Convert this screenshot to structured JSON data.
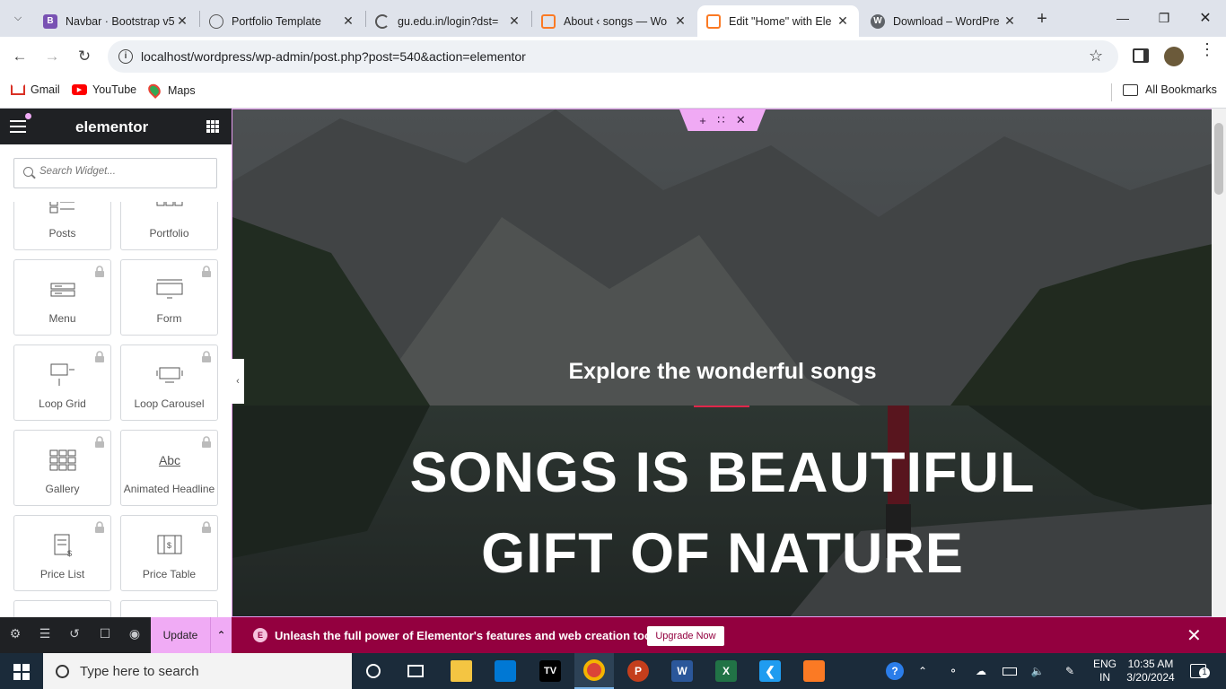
{
  "browser": {
    "tabs": [
      {
        "label": "Navbar · Bootstrap v5",
        "favicon": "bootstrap-icon",
        "color": "#7952b3",
        "glyph": "B"
      },
      {
        "label": "Portfolio Template",
        "favicon": "globe-icon",
        "color": "#5f6368",
        "glyph": ""
      },
      {
        "label": "gu.edu.in/login?dst=",
        "favicon": "loading-icon",
        "color": "#5f6368",
        "glyph": ""
      },
      {
        "label": "About ‹ songs — Wo",
        "favicon": "xampp-icon",
        "color": "#fb7a24",
        "glyph": ""
      },
      {
        "label": "Edit \"Home\" with Ele",
        "favicon": "xampp-icon",
        "color": "#fb7a24",
        "glyph": ""
      },
      {
        "label": "Download – WordPre",
        "favicon": "wordpress-icon",
        "color": "#5f6368",
        "glyph": "W"
      }
    ],
    "active_tab_index": 4,
    "url": "localhost/wordpress/wp-admin/post.php?post=540&action=elementor",
    "bookmarks": [
      {
        "label": "Gmail",
        "icon": "gmail-icon"
      },
      {
        "label": "YouTube",
        "icon": "youtube-icon"
      },
      {
        "label": "Maps",
        "icon": "maps-icon"
      }
    ],
    "all_bookmarks_label": "All Bookmarks"
  },
  "elementor": {
    "logo": "elementor",
    "search_placeholder": "Search Widget...",
    "widgets": [
      {
        "label": "Posts",
        "icon": "posts-icon",
        "locked": false
      },
      {
        "label": "Portfolio",
        "icon": "portfolio-icon",
        "locked": false
      },
      {
        "label": "Menu",
        "icon": "menu-icon",
        "locked": true
      },
      {
        "label": "Form",
        "icon": "form-icon",
        "locked": true
      },
      {
        "label": "Loop Grid",
        "icon": "loop-grid-icon",
        "locked": true
      },
      {
        "label": "Loop Carousel",
        "icon": "loop-carousel-icon",
        "locked": true
      },
      {
        "label": "Gallery",
        "icon": "gallery-icon",
        "locked": true
      },
      {
        "label": "Animated Headline",
        "icon": "animated-headline-icon",
        "locked": true
      },
      {
        "label": "Price List",
        "icon": "price-list-icon",
        "locked": true
      },
      {
        "label": "Price Table",
        "icon": "price-table-icon",
        "locked": true
      }
    ],
    "update_label": "Update",
    "promo_text": "Unleash the full power of Elementor's features and web creation tools.",
    "promo_button": "Upgrade Now",
    "accent": "#f0abf5",
    "promo_color": "#93003f"
  },
  "hero": {
    "subtitle": "Explore the wonderful songs",
    "headline_line1": "SONGS IS BEAUTIFUL",
    "headline_line2": "GIFT OF NATURE",
    "divider_color": "#e0264a"
  },
  "taskbar": {
    "search_placeholder": "Type here to search",
    "language_top": "ENG",
    "language_bottom": "IN",
    "time": "10:35 AM",
    "date": "3/20/2024",
    "notification_count": "1"
  }
}
